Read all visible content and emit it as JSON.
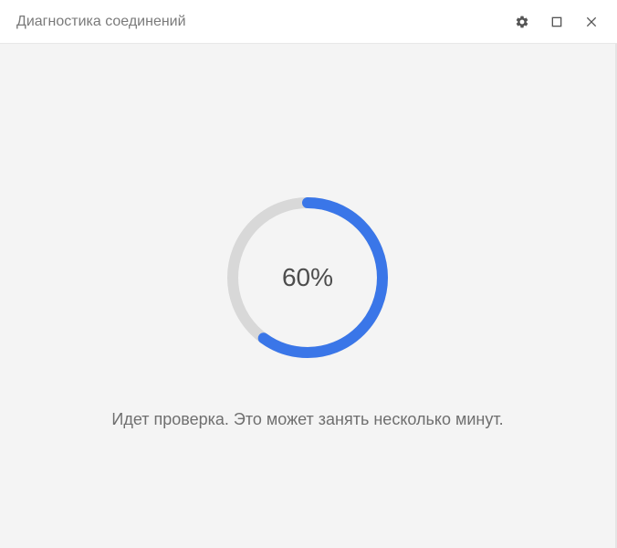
{
  "titlebar": {
    "title": "Диагностика соединений"
  },
  "progress": {
    "percent": 60,
    "label": "60%"
  },
  "status": {
    "message": "Идет проверка. Это может занять несколько минут."
  },
  "colors": {
    "accent": "#3a76e8",
    "track": "#d8d8d8"
  }
}
